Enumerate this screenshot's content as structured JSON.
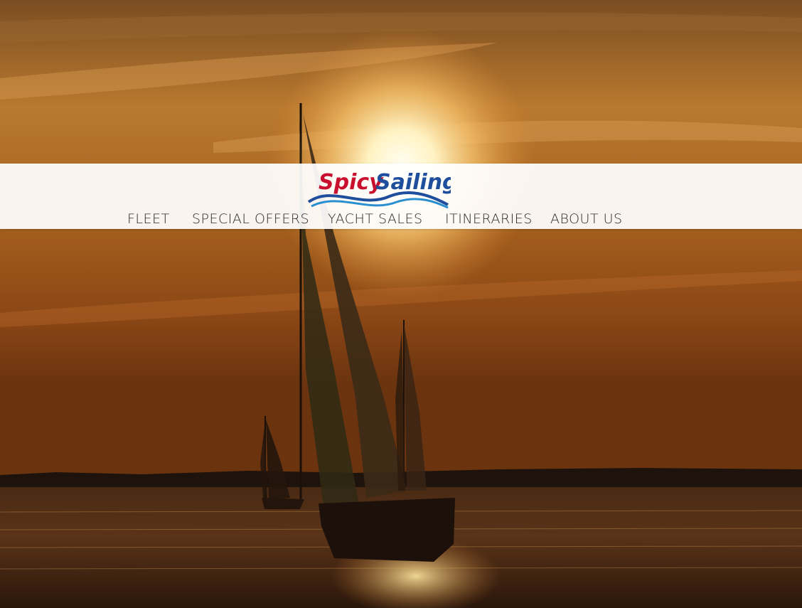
{
  "brand": {
    "logo_text_part1": "Spicy",
    "logo_text_part2": "Sailing",
    "logo_color_primary": "#c8102e",
    "logo_color_secondary": "#1f4e9c",
    "logo_wave_color": "#2a8fd0"
  },
  "nav": {
    "items": [
      {
        "label": "FLEET"
      },
      {
        "label": "SPECIAL OFFERS"
      },
      {
        "label": "YACHT SALES"
      },
      {
        "label": "ITINERARIES"
      },
      {
        "label": "ABOUT US"
      }
    ]
  },
  "hero": {
    "image": "sailboat-sunset-photo",
    "colors": {
      "sky_top": "#8a5a26",
      "sun": "#fff6cf",
      "sea": "#2b170b",
      "shore": "#1c120c"
    }
  }
}
